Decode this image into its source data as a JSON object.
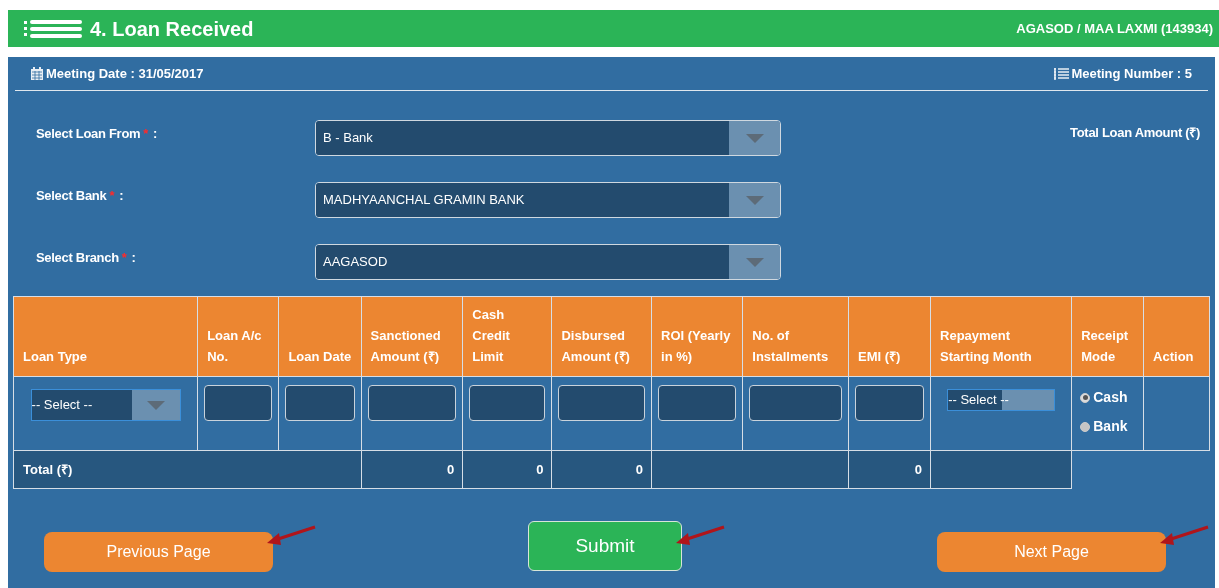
{
  "header": {
    "title": "4. Loan Received",
    "group": "AGASOD / MAA LAXMI (143934)"
  },
  "meeting": {
    "date": "Meeting Date : 31/05/2017",
    "number": "Meeting Number : 5"
  },
  "form_fields": [
    {
      "label": "Select Loan From",
      "required": true,
      "required_mark": "*",
      "separator": ":",
      "value": "B - Bank"
    },
    {
      "label": "Select Bank",
      "required": true,
      "required_mark": "*",
      "separator": ":",
      "value": "MADHYAANCHAL GRAMIN BANK"
    },
    {
      "label": "Select Branch",
      "required": true,
      "required_mark": "*",
      "separator": ":",
      "value": "AAGASOD"
    }
  ],
  "total_loan_label": "Total Loan Amount (₹)",
  "table": {
    "columns": [
      {
        "label": "Loan Type",
        "kind": "select",
        "value": "-- Select --"
      },
      {
        "label": "Loan A/c No.",
        "kind": "input"
      },
      {
        "label": "Loan Date",
        "kind": "input"
      },
      {
        "label": "Sanctioned Amount (₹)",
        "kind": "input"
      },
      {
        "label": "Cash Credit Limit",
        "kind": "input"
      },
      {
        "label": "Disbursed Amount (₹)",
        "kind": "input"
      },
      {
        "label": "ROI (Yearly in %)",
        "kind": "input"
      },
      {
        "label": "No. of Installments",
        "kind": "input"
      },
      {
        "label": "EMI (₹)",
        "kind": "input"
      },
      {
        "label": "Repayment Starting Month",
        "kind": "small-select",
        "value": "-- Select --"
      },
      {
        "label": "Receipt Mode",
        "kind": "radio",
        "options": [
          {
            "label": "Cash",
            "selected": true
          },
          {
            "label": "Bank",
            "selected": false
          }
        ]
      },
      {
        "label": "Action",
        "kind": "empty"
      }
    ],
    "total_row": {
      "label": "Total (₹)",
      "sanctioned": "0",
      "cash_credit": "0",
      "disbursed": "0",
      "emi": "0"
    }
  },
  "buttons": [
    {
      "label": "Previous Page",
      "kind": "secondary"
    },
    {
      "label": "Submit",
      "kind": "primary"
    },
    {
      "label": "Next Page",
      "kind": "secondary"
    }
  ]
}
